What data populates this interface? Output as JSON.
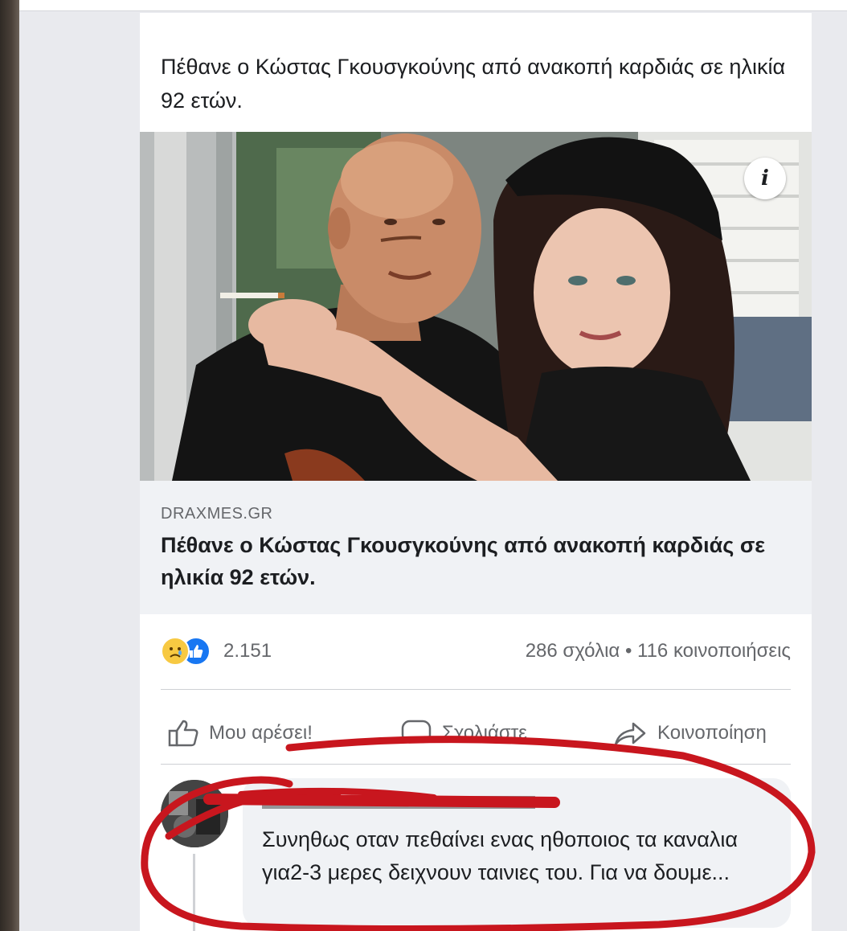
{
  "post": {
    "text": "Πέθανε ο Κώστας Γκουσγκούνης από ανακοπή καρδιάς σε ηλικία 92 ετών."
  },
  "link_preview": {
    "domain": "DRAXMES.GR",
    "title": "Πέθανε ο Κώστας Γκουσγκούνης από ανακοπή καρδιάς σε ηλικία 92 ετών.",
    "info_icon": "info-icon"
  },
  "stats": {
    "reaction_icons": [
      "sad-reaction-icon",
      "like-reaction-icon"
    ],
    "reaction_count": "2.151",
    "comments_shares": "286 σχόλια • 116 κοινοποιήσεις"
  },
  "actions": {
    "like_label": "Μου αρέσει!",
    "comment_label": "Σχολιάστε",
    "share_label": "Κοινοποίηση"
  },
  "comment": {
    "text": "Συνηθως οταν πεθαίνει ενας ηθοποιος τα καναλια για2-3 μερες δειχνουν ταινιες του. Για να δουμε..."
  },
  "colors": {
    "annotation_red": "#c8161e",
    "facebook_blue": "#1877f2",
    "secondary_text": "#65676b"
  }
}
